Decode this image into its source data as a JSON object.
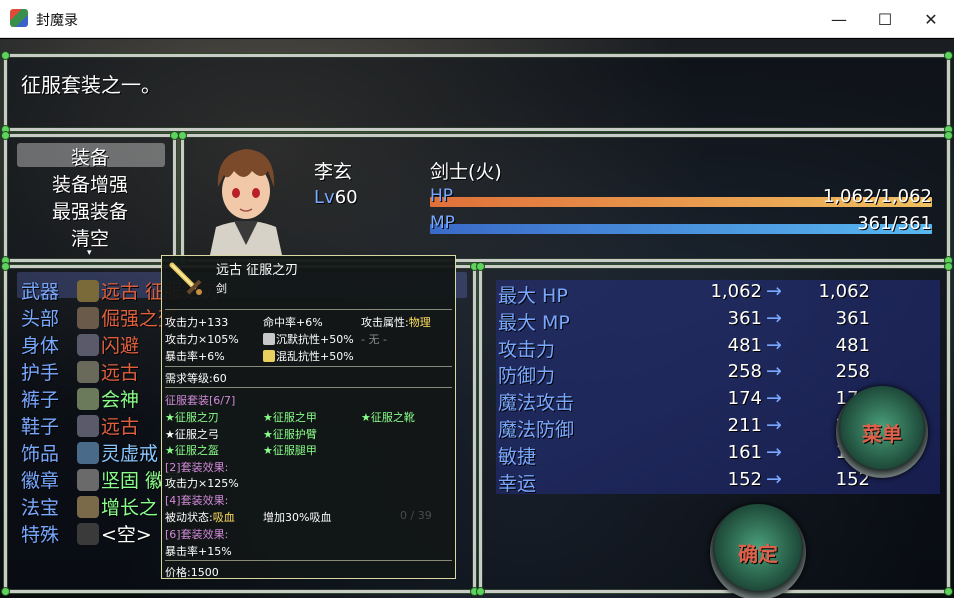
{
  "window": {
    "title": "封魔录",
    "minimize": "—",
    "maximize": "☐",
    "close": "✕"
  },
  "help": {
    "text": "征服套装之一。"
  },
  "commands": {
    "items": [
      "装备",
      "装备增强",
      "最强装备",
      "清空"
    ],
    "more": "▾"
  },
  "actor": {
    "name": "李玄",
    "lv_label": "Lv",
    "level": "60",
    "class": "剑士(火)",
    "hp_label": "HP",
    "hp_value": "1,062/1,062",
    "mp_label": "MP",
    "mp_value": "361/361"
  },
  "slots": [
    {
      "label": "武器",
      "name": "远古 征服之刃",
      "color": "#e0603e"
    },
    {
      "label": "头部",
      "name": "倔强之盔",
      "color": "#e0603e"
    },
    {
      "label": "身体",
      "name": "闪避",
      "color": "#e0603e"
    },
    {
      "label": "护手",
      "name": "远古",
      "color": "#e0603e"
    },
    {
      "label": "裤子",
      "name": "会神",
      "color": "#8aff8a"
    },
    {
      "label": "鞋子",
      "name": "远古",
      "color": "#e0603e"
    },
    {
      "label": "饰品",
      "name": "灵虚戒",
      "color": "#8ac8ff"
    },
    {
      "label": "徽章",
      "name": "坚固 徽章",
      "color": "#8aff8a"
    },
    {
      "label": "法宝",
      "name": "增长之",
      "color": "#8aff8a"
    },
    {
      "label": "特殊",
      "name": "<空>",
      "color": "#ffffff"
    }
  ],
  "params": [
    {
      "name": "最大 HP",
      "old": "1,062",
      "new": "1,062"
    },
    {
      "name": "最大 MP",
      "old": "361",
      "new": "361"
    },
    {
      "name": "攻击力",
      "old": "481",
      "new": "481"
    },
    {
      "name": "防御力",
      "old": "258",
      "new": "258"
    },
    {
      "name": "魔法攻击",
      "old": "174",
      "new": "174"
    },
    {
      "name": "魔法防御",
      "old": "211",
      "new": "211"
    },
    {
      "name": "敏捷",
      "old": "161",
      "new": "161"
    },
    {
      "name": "幸运",
      "old": "152",
      "new": "152"
    }
  ],
  "param_arrow": "→",
  "buttons": {
    "menu": "菜单",
    "confirm": "确定"
  },
  "tooltip": {
    "name": "远古 征服之刃",
    "type": "剑",
    "atk": "攻击力+133",
    "hit": "命中率+6%",
    "elem_label": "攻击属性:",
    "elem": "物理",
    "atk_rate": "攻击力×105%",
    "silence": "沉默抗性+50%",
    "none": "- 无 -",
    "crit": "暴击率+6%",
    "confuse": "混乱抗性+50%",
    "req_level": "需求等级:60",
    "set_title": "征服套装[6/7]",
    "set_items": [
      "★征服之刃",
      "★征服之甲",
      "★征服之靴",
      "★征服之弓",
      "★征服护臂",
      "★征服之盔",
      "★征服腿甲"
    ],
    "bonus2_title": "[2]套装效果:",
    "bonus2": "攻击力×125%",
    "bonus4_title": "[4]套装效果:",
    "bonus4_label": "被动状态:",
    "bonus4_value": "吸血",
    "bonus4_desc": "增加30%吸血",
    "counter": "0 / 39",
    "bonus6_title": "[6]套装效果:",
    "bonus6": "暴击率+15%",
    "price": "价格:1500"
  }
}
